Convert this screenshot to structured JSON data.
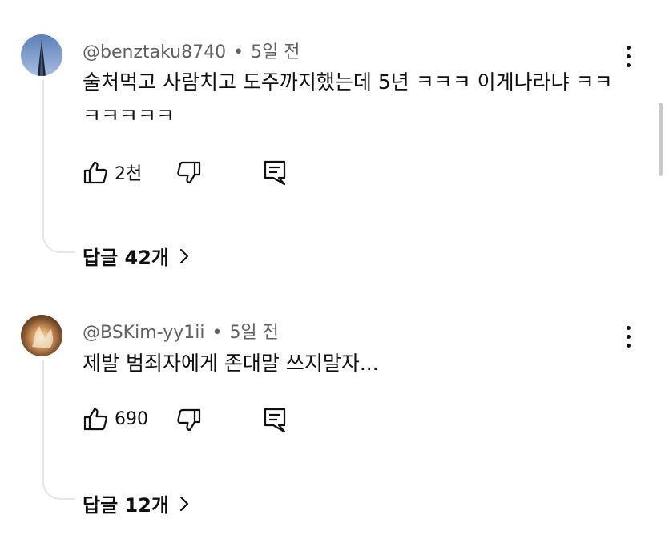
{
  "comments": [
    {
      "author": "@benztaku8740",
      "separator": "•",
      "time": "5일 전",
      "text": "술처먹고 사람치고 도주까지했는데 5년 ㅋㅋㅋ 이게나라냐 ㅋㅋㅋㅋㅋㅋㅋ",
      "likes": "2천",
      "replies_label": "답글 42개",
      "avatar_icon": "tower-photo"
    },
    {
      "author": "@BSKim-yy1ii",
      "separator": "•",
      "time": "5일 전",
      "text": "제발 범죄자에게 존대말 쓰지말자...",
      "likes": "690",
      "replies_label": "답글 12개",
      "avatar_icon": "fire-photo"
    }
  ],
  "icons": {
    "like": "thumbs-up-icon",
    "dislike": "thumbs-down-icon",
    "reply": "comment-icon",
    "more": "more-vert-icon",
    "expand": "chevron-right-icon"
  }
}
